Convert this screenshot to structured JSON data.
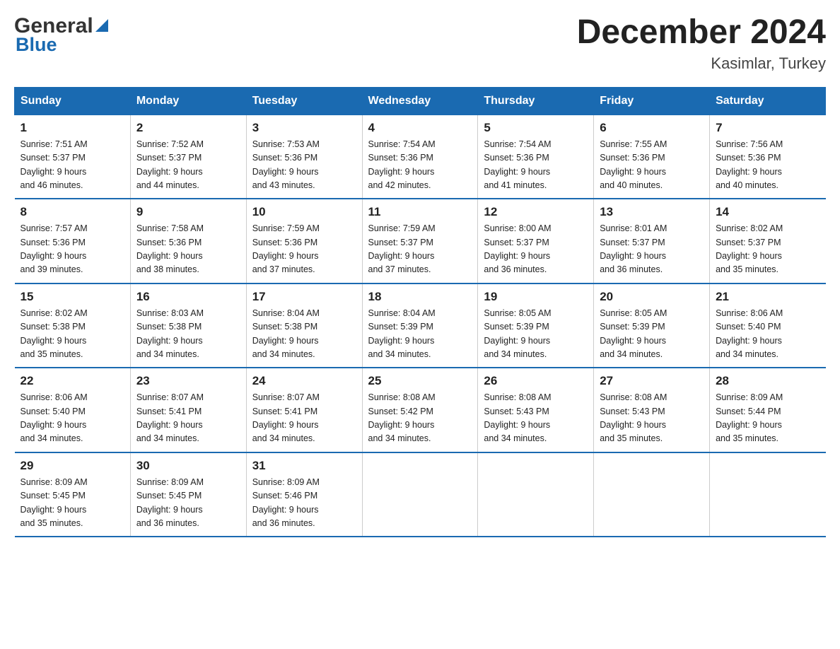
{
  "header": {
    "logo_general": "General",
    "logo_blue": "Blue",
    "month_year": "December 2024",
    "location": "Kasimlar, Turkey"
  },
  "days_of_week": [
    "Sunday",
    "Monday",
    "Tuesday",
    "Wednesday",
    "Thursday",
    "Friday",
    "Saturday"
  ],
  "weeks": [
    [
      {
        "num": "1",
        "sunrise": "7:51 AM",
        "sunset": "5:37 PM",
        "daylight": "9 hours and 46 minutes."
      },
      {
        "num": "2",
        "sunrise": "7:52 AM",
        "sunset": "5:37 PM",
        "daylight": "9 hours and 44 minutes."
      },
      {
        "num": "3",
        "sunrise": "7:53 AM",
        "sunset": "5:36 PM",
        "daylight": "9 hours and 43 minutes."
      },
      {
        "num": "4",
        "sunrise": "7:54 AM",
        "sunset": "5:36 PM",
        "daylight": "9 hours and 42 minutes."
      },
      {
        "num": "5",
        "sunrise": "7:54 AM",
        "sunset": "5:36 PM",
        "daylight": "9 hours and 41 minutes."
      },
      {
        "num": "6",
        "sunrise": "7:55 AM",
        "sunset": "5:36 PM",
        "daylight": "9 hours and 40 minutes."
      },
      {
        "num": "7",
        "sunrise": "7:56 AM",
        "sunset": "5:36 PM",
        "daylight": "9 hours and 40 minutes."
      }
    ],
    [
      {
        "num": "8",
        "sunrise": "7:57 AM",
        "sunset": "5:36 PM",
        "daylight": "9 hours and 39 minutes."
      },
      {
        "num": "9",
        "sunrise": "7:58 AM",
        "sunset": "5:36 PM",
        "daylight": "9 hours and 38 minutes."
      },
      {
        "num": "10",
        "sunrise": "7:59 AM",
        "sunset": "5:36 PM",
        "daylight": "9 hours and 37 minutes."
      },
      {
        "num": "11",
        "sunrise": "7:59 AM",
        "sunset": "5:37 PM",
        "daylight": "9 hours and 37 minutes."
      },
      {
        "num": "12",
        "sunrise": "8:00 AM",
        "sunset": "5:37 PM",
        "daylight": "9 hours and 36 minutes."
      },
      {
        "num": "13",
        "sunrise": "8:01 AM",
        "sunset": "5:37 PM",
        "daylight": "9 hours and 36 minutes."
      },
      {
        "num": "14",
        "sunrise": "8:02 AM",
        "sunset": "5:37 PM",
        "daylight": "9 hours and 35 minutes."
      }
    ],
    [
      {
        "num": "15",
        "sunrise": "8:02 AM",
        "sunset": "5:38 PM",
        "daylight": "9 hours and 35 minutes."
      },
      {
        "num": "16",
        "sunrise": "8:03 AM",
        "sunset": "5:38 PM",
        "daylight": "9 hours and 34 minutes."
      },
      {
        "num": "17",
        "sunrise": "8:04 AM",
        "sunset": "5:38 PM",
        "daylight": "9 hours and 34 minutes."
      },
      {
        "num": "18",
        "sunrise": "8:04 AM",
        "sunset": "5:39 PM",
        "daylight": "9 hours and 34 minutes."
      },
      {
        "num": "19",
        "sunrise": "8:05 AM",
        "sunset": "5:39 PM",
        "daylight": "9 hours and 34 minutes."
      },
      {
        "num": "20",
        "sunrise": "8:05 AM",
        "sunset": "5:39 PM",
        "daylight": "9 hours and 34 minutes."
      },
      {
        "num": "21",
        "sunrise": "8:06 AM",
        "sunset": "5:40 PM",
        "daylight": "9 hours and 34 minutes."
      }
    ],
    [
      {
        "num": "22",
        "sunrise": "8:06 AM",
        "sunset": "5:40 PM",
        "daylight": "9 hours and 34 minutes."
      },
      {
        "num": "23",
        "sunrise": "8:07 AM",
        "sunset": "5:41 PM",
        "daylight": "9 hours and 34 minutes."
      },
      {
        "num": "24",
        "sunrise": "8:07 AM",
        "sunset": "5:41 PM",
        "daylight": "9 hours and 34 minutes."
      },
      {
        "num": "25",
        "sunrise": "8:08 AM",
        "sunset": "5:42 PM",
        "daylight": "9 hours and 34 minutes."
      },
      {
        "num": "26",
        "sunrise": "8:08 AM",
        "sunset": "5:43 PM",
        "daylight": "9 hours and 34 minutes."
      },
      {
        "num": "27",
        "sunrise": "8:08 AM",
        "sunset": "5:43 PM",
        "daylight": "9 hours and 35 minutes."
      },
      {
        "num": "28",
        "sunrise": "8:09 AM",
        "sunset": "5:44 PM",
        "daylight": "9 hours and 35 minutes."
      }
    ],
    [
      {
        "num": "29",
        "sunrise": "8:09 AM",
        "sunset": "5:45 PM",
        "daylight": "9 hours and 35 minutes."
      },
      {
        "num": "30",
        "sunrise": "8:09 AM",
        "sunset": "5:45 PM",
        "daylight": "9 hours and 36 minutes."
      },
      {
        "num": "31",
        "sunrise": "8:09 AM",
        "sunset": "5:46 PM",
        "daylight": "9 hours and 36 minutes."
      },
      null,
      null,
      null,
      null
    ]
  ],
  "labels": {
    "sunrise": "Sunrise:",
    "sunset": "Sunset:",
    "daylight": "Daylight:"
  }
}
